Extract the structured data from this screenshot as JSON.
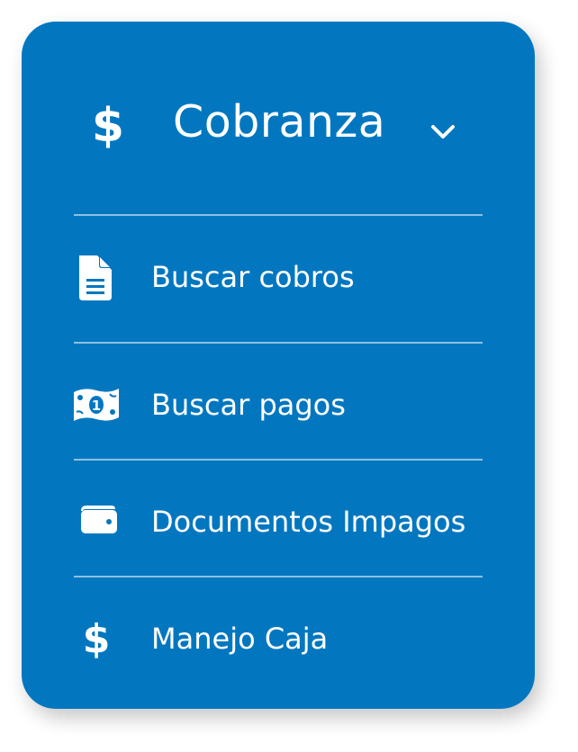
{
  "menu": {
    "header": {
      "title": "Cobranza",
      "icon": "dollar-icon",
      "toggle_icon": "chevron-down-icon"
    },
    "items": [
      {
        "label": "Buscar cobros",
        "icon": "document-icon"
      },
      {
        "label": "Buscar pagos",
        "icon": "banknote-icon"
      },
      {
        "label": "Documentos Impagos",
        "icon": "wallet-icon"
      },
      {
        "label": "Manejo Caja",
        "icon": "dollar-icon"
      }
    ]
  },
  "colors": {
    "card_background": "#0277c0",
    "text": "#ffffff"
  }
}
